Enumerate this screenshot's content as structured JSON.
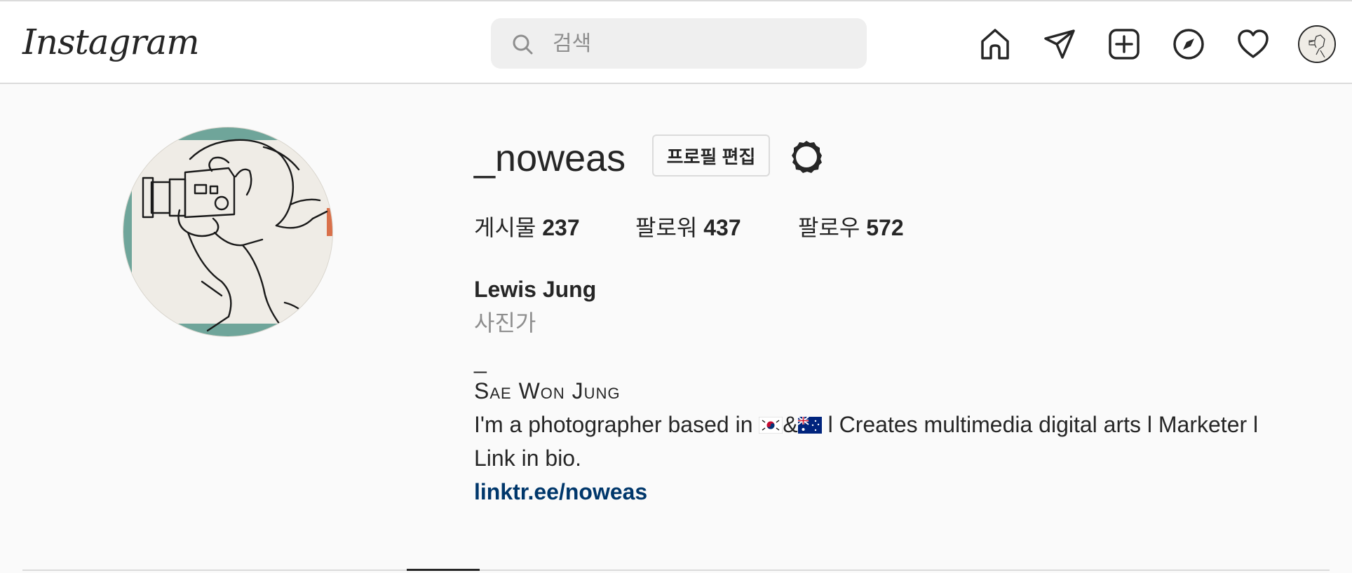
{
  "header": {
    "logo_text": "Instagram",
    "search": {
      "placeholder": "검색",
      "value": ""
    },
    "nav_icons": [
      "home-icon",
      "direct-message-icon",
      "new-post-icon",
      "explore-icon",
      "activity-heart-icon",
      "profile-avatar"
    ]
  },
  "profile": {
    "username": "_noweas",
    "edit_button": "프로필 편집",
    "stats": {
      "posts_label": "게시물",
      "posts_count": "237",
      "followers_label": "팔로워",
      "followers_count": "437",
      "following_label": "팔로우",
      "following_count": "572"
    },
    "full_name": "Lewis Jung",
    "category": "사진가",
    "bio": {
      "dash": "_",
      "name_line": "Sae Won Jung",
      "desc_part1": "I'm a photographer based in ",
      "flag_1": "south-korea-flag",
      "amp": "&",
      "flag_2": "australia-flag",
      "desc_part2": " l Creates multimedia digital arts l Marketer l",
      "desc_line2": "Link in bio."
    },
    "link": "linktr.ee/noweas"
  },
  "colors": {
    "text": "#262626",
    "secondary_text": "#8e8e8e",
    "link": "#00376b",
    "border": "#dbdbdb",
    "background": "#fafafa",
    "search_bg": "#efefef"
  }
}
